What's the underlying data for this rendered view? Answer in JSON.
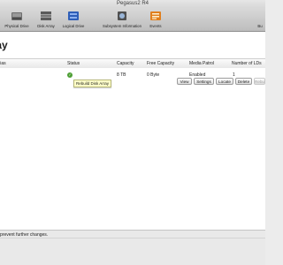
{
  "window": {
    "title": "Pegasus2 R4"
  },
  "toolbar": {
    "items": [
      {
        "label": "Physical Drive",
        "icon": "physical-drive-icon"
      },
      {
        "label": "Disk Array",
        "icon": "disk-array-icon"
      },
      {
        "label": "Logical Drive",
        "icon": "logical-drive-icon"
      },
      {
        "label": "Subsystem Information",
        "icon": "subsystem-info-icon"
      },
      {
        "label": "Events",
        "icon": "events-icon"
      }
    ],
    "right_truncated": "Bu"
  },
  "main": {
    "page_title": "rray",
    "table": {
      "columns": [
        "ilias",
        "Status",
        "Capacity",
        "Free Capacity",
        "Media Patrol",
        "Number of LDs"
      ],
      "rows": [
        {
          "status": "ok",
          "capacity": "8 TB",
          "free_capacity": "0 Byte",
          "media_patrol": "Enabled",
          "number_of_lds": "1"
        }
      ]
    },
    "tooltip": "Rebuild Disk Array",
    "row_buttons": {
      "view": "View",
      "settings": "Settings",
      "locate": "Locate",
      "delete": "Delete",
      "rebuild_truncated": "Rebu"
    }
  },
  "statusbar": {
    "text": "prevent further changes."
  },
  "colors": {
    "status_ok": "#4e9f35",
    "tooltip_bg": "#ffffc8"
  }
}
